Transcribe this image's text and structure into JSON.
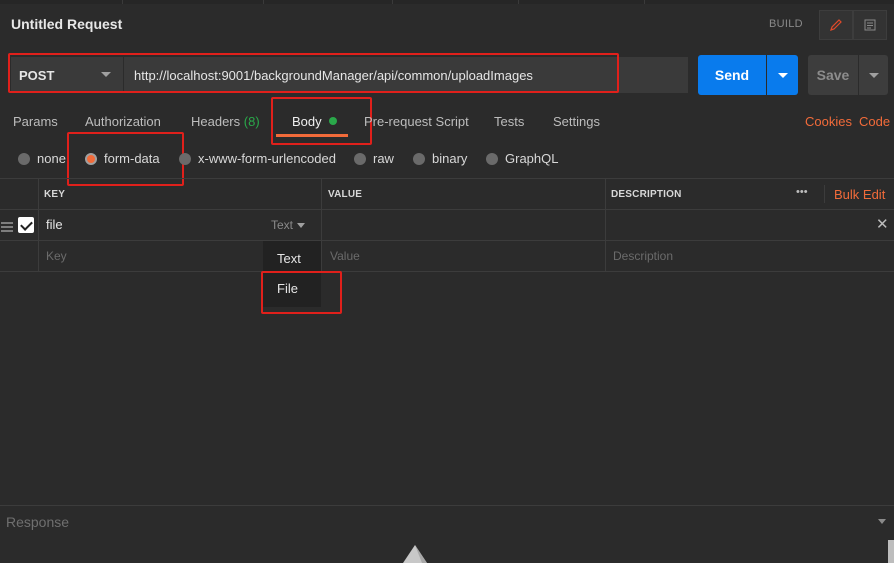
{
  "header": {
    "title": "Untitled Request",
    "build_label": "BUILD"
  },
  "request": {
    "method": "POST",
    "url": "http://localhost:9001/backgroundManager/api/common/uploadImages",
    "send_label": "Send",
    "save_label": "Save"
  },
  "tabs": {
    "params": "Params",
    "authorization": "Authorization",
    "headers": "Headers",
    "headers_count": "(8)",
    "body": "Body",
    "prerequest": "Pre-request Script",
    "tests": "Tests",
    "settings": "Settings",
    "cookies": "Cookies",
    "code": "Code"
  },
  "body_types": {
    "none": "none",
    "form_data": "form-data",
    "urlencoded": "x-www-form-urlencoded",
    "raw": "raw",
    "binary": "binary",
    "graphql": "GraphQL",
    "selected": "form-data"
  },
  "table": {
    "headers": {
      "key": "KEY",
      "value": "VALUE",
      "description": "DESCRIPTION"
    },
    "more_label": "•••",
    "bulk_edit": "Bulk Edit",
    "rows": [
      {
        "key": "file",
        "type": "Text",
        "checked": true
      }
    ],
    "placeholders": {
      "key": "Key",
      "value": "Value",
      "description": "Description"
    },
    "type_options": [
      "Text",
      "File"
    ]
  },
  "response": {
    "label": "Response"
  },
  "colors": {
    "accent": "#f26b3a",
    "send": "#097bed",
    "annotation": "#e0201b",
    "status_green": "#2aa84a"
  }
}
